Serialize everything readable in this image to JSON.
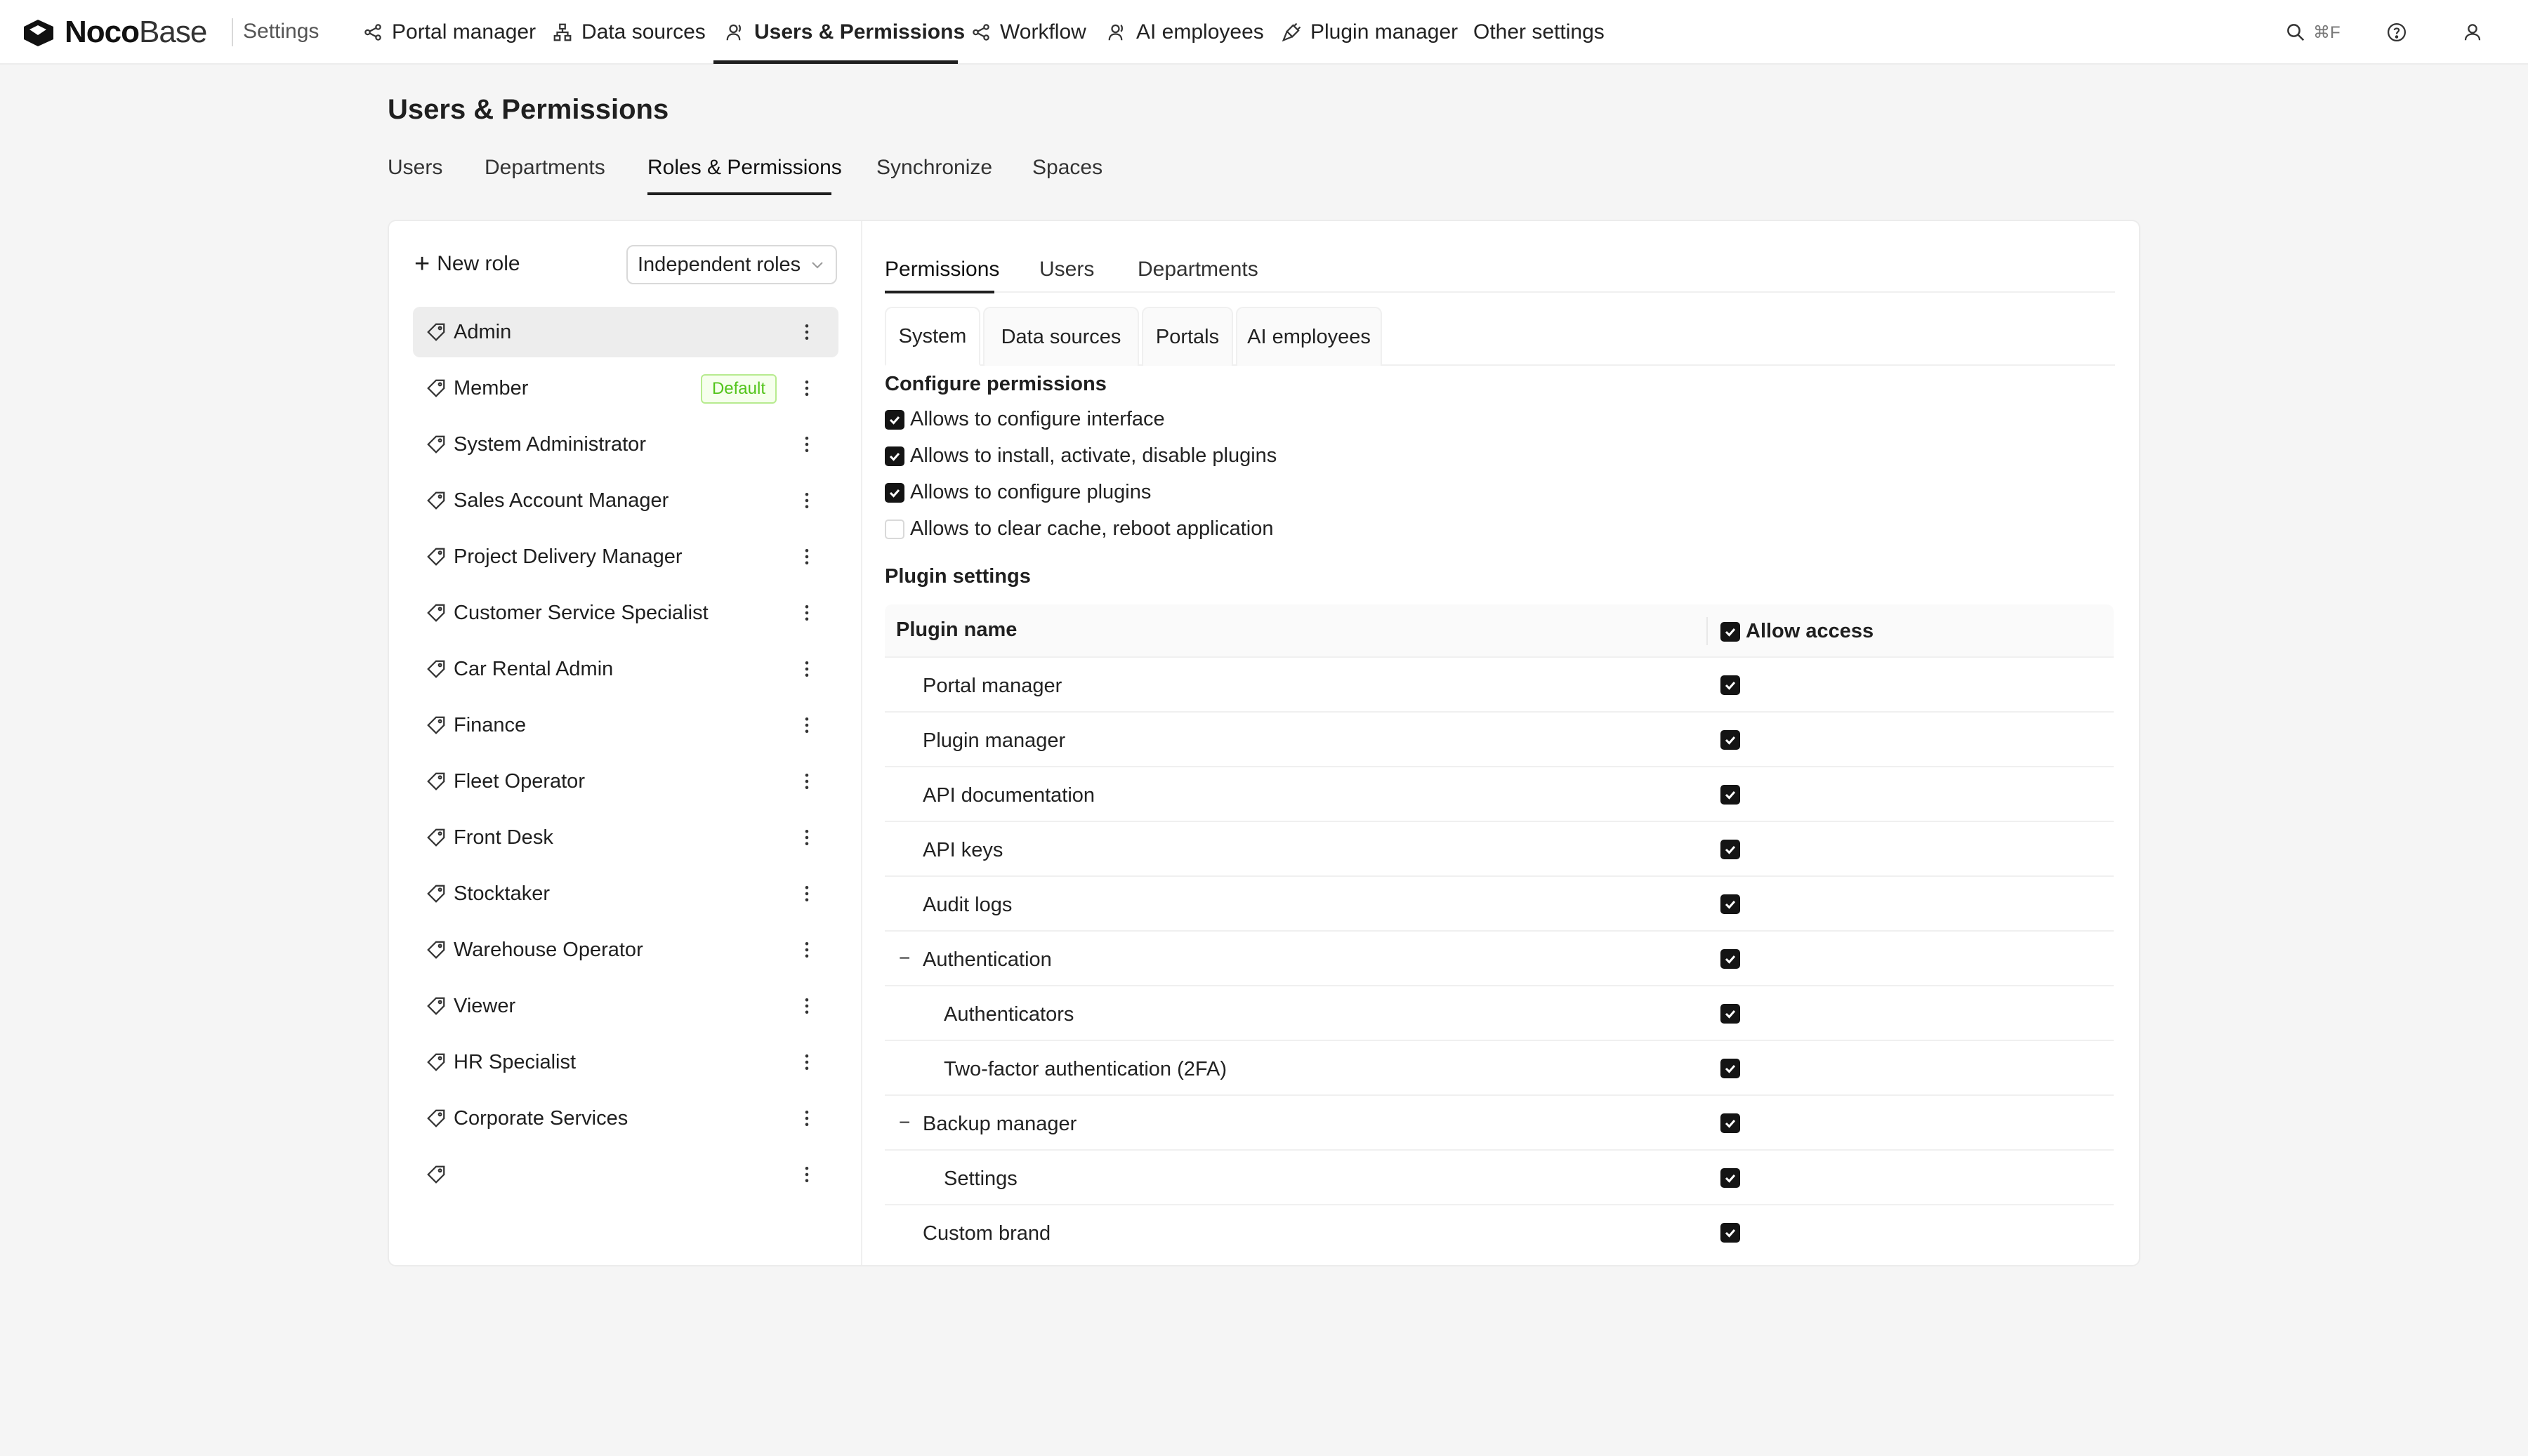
{
  "brand": {
    "name_bold": "Noco",
    "name_light": "Base",
    "section": "Settings"
  },
  "topnav": [
    {
      "label": "Portal manager",
      "icon": "share-nodes-icon"
    },
    {
      "label": "Data sources",
      "icon": "sitemap-icon"
    },
    {
      "label": "Users & Permissions",
      "icon": "users-icon",
      "active": true
    },
    {
      "label": "Workflow",
      "icon": "share-nodes-icon"
    },
    {
      "label": "AI employees",
      "icon": "users-icon"
    },
    {
      "label": "Plugin manager",
      "icon": "plug-icon"
    },
    {
      "label": "Other settings"
    }
  ],
  "topright": {
    "search_shortcut": "⌘F",
    "icons": [
      "search-icon",
      "help-icon",
      "user-icon"
    ]
  },
  "page": {
    "title": "Users & Permissions",
    "tabs": [
      "Users",
      "Departments",
      "Roles & Permissions",
      "Synchronize",
      "Spaces"
    ],
    "active_tab": "Roles & Permissions"
  },
  "roles_panel": {
    "new_role_label": "New role",
    "mode_select": "Independent roles",
    "default_badge": "Default",
    "roles": [
      "Admin",
      "Member",
      "System Administrator",
      "Sales Account Manager",
      "Project Delivery Manager",
      "Customer Service Specialist",
      "Car Rental Admin",
      "Finance",
      "Fleet Operator",
      "Front Desk",
      "Stocktaker",
      "Warehouse Operator",
      "Viewer",
      "HR Specialist",
      "Corporate Services",
      ""
    ],
    "selected_role": "Admin"
  },
  "permissions": {
    "tabs": [
      "Permissions",
      "Users",
      "Departments"
    ],
    "sub_tabs": [
      "System",
      "Data sources",
      "Portals",
      "AI employees"
    ],
    "configure_heading": "Configure permissions",
    "configure_items": [
      {
        "label": "Allows to configure interface",
        "checked": true
      },
      {
        "label": "Allows to install, activate, disable plugins",
        "checked": true
      },
      {
        "label": "Allows to configure plugins",
        "checked": true
      },
      {
        "label": "Allows to clear cache, reboot application",
        "checked": false
      }
    ],
    "plugin_heading": "Plugin settings",
    "table": {
      "col_name": "Plugin name",
      "col_access": "Allow access",
      "rows": [
        {
          "name": "Portal manager",
          "level": 0,
          "checked": true
        },
        {
          "name": "Plugin manager",
          "level": 0,
          "checked": true
        },
        {
          "name": "API documentation",
          "level": 0,
          "checked": true
        },
        {
          "name": "API keys",
          "level": 0,
          "checked": true
        },
        {
          "name": "Audit logs",
          "level": 0,
          "checked": true
        },
        {
          "name": "Authentication",
          "level": 0,
          "expanded": true,
          "toggle": "−",
          "checked": true
        },
        {
          "name": "Authenticators",
          "level": 1,
          "checked": true
        },
        {
          "name": "Two-factor authentication (2FA)",
          "level": 1,
          "checked": true
        },
        {
          "name": "Backup manager",
          "level": 0,
          "expanded": true,
          "toggle": "−",
          "checked": true
        },
        {
          "name": "Settings",
          "level": 1,
          "checked": true
        },
        {
          "name": "Custom brand",
          "level": 0,
          "checked": true
        }
      ]
    }
  },
  "colors": {
    "accent": "#1f1f1f",
    "badge_green": "#52c41a",
    "background": "#f5f5f5"
  }
}
